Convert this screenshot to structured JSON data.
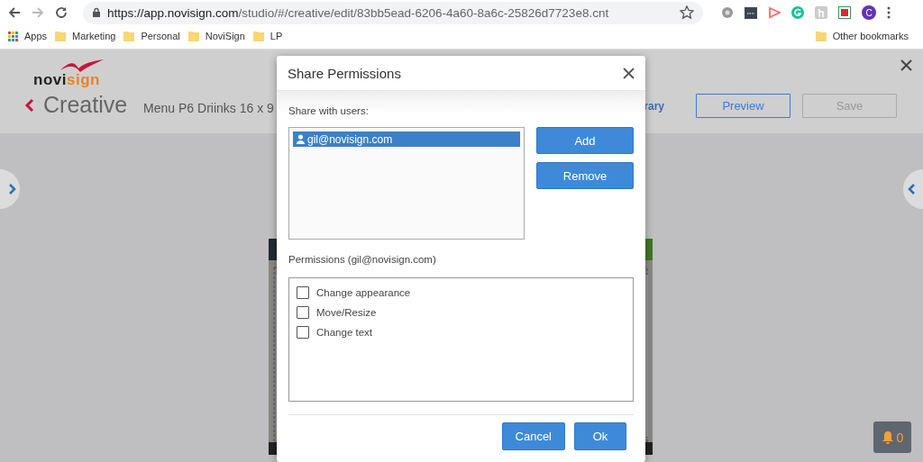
{
  "browser": {
    "url_host": "https://app.novisign.com",
    "url_path": "/studio/#/creative/edit/83bb5ead-6206-4a60-8a6c-25826d7723e8.cnt",
    "profile_initial": "C",
    "bookmarks": [
      {
        "label": "Apps",
        "kind": "apps"
      },
      {
        "label": "Marketing",
        "kind": "folder"
      },
      {
        "label": "Personal",
        "kind": "folder"
      },
      {
        "label": "NoviSign",
        "kind": "folder"
      },
      {
        "label": "LP",
        "kind": "folder"
      }
    ],
    "other_bookmarks": "Other bookmarks"
  },
  "app": {
    "logo": [
      "novi",
      "sign"
    ],
    "title": "Creative",
    "creative_name": "Menu P6 Driinks 16 x 9",
    "library_link": "rary",
    "buttons": [
      {
        "label": "Preview",
        "disabled": false
      },
      {
        "label": "Save",
        "disabled": true
      }
    ],
    "notifications": "0"
  },
  "dialog": {
    "title": "Share Permissions",
    "users_label": "Share with users:",
    "users": [
      {
        "email": "gil@novisign.com",
        "selected": true
      }
    ],
    "actions": [
      "Add",
      "Remove"
    ],
    "permissions_label": "Permissions (gil@novisign.com)",
    "permissions": [
      {
        "label": "Change appearance",
        "checked": false
      },
      {
        "label": "Move/Resize",
        "checked": false
      },
      {
        "label": "Change text",
        "checked": false
      }
    ],
    "footer_buttons": [
      "Cancel",
      "Ok"
    ]
  }
}
